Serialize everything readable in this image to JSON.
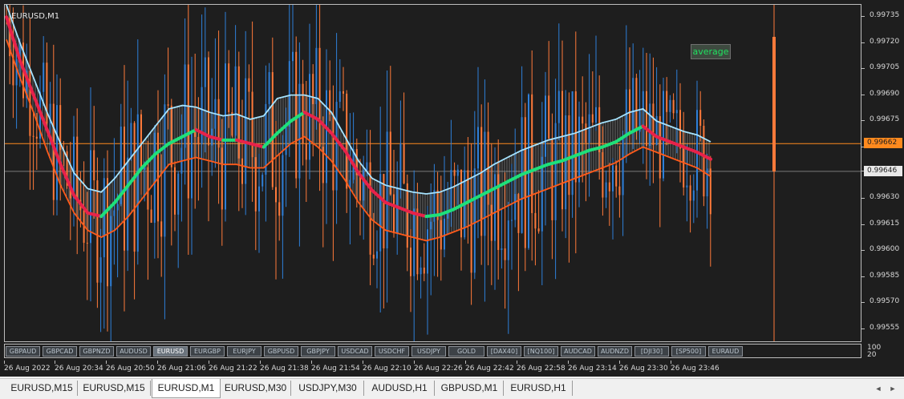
{
  "chart": {
    "title": "EURUSD,M1",
    "indicator_label": "average"
  },
  "chart_data": {
    "type": "candlestick",
    "symbol": "EURUSD",
    "timeframe": "M1",
    "y_range": [
      0.99548,
      0.99742
    ],
    "price_ticks": [
      "0.99735",
      "0.99720",
      "0.99705",
      "0.99690",
      "0.99675",
      "0.99660",
      "0.99646",
      "0.99630",
      "0.99615",
      "0.99600",
      "0.99585",
      "0.99570",
      "0.99555"
    ],
    "current_price": "0.99662",
    "bid_price": "0.99646",
    "time_ticks": [
      "26 Aug 2022",
      "26 Aug 20:34",
      "26 Aug 20:50",
      "26 Aug 21:06",
      "26 Aug 21:22",
      "26 Aug 21:38",
      "26 Aug 21:54",
      "26 Aug 22:10",
      "26 Aug 22:26",
      "26 Aug 22:42",
      "26 Aug 22:58",
      "26 Aug 23:14",
      "26 Aug 23:30",
      "26 Aug 23:46"
    ],
    "bullish_color": "#2e7fd8",
    "bearish_color": "#ff7a3a",
    "ma_up_color": "#1ee07a",
    "ma_down_color": "#e8224a",
    "upper_band_color": "#a6e4ff",
    "lower_band_color": "#ff5a1a",
    "ma": [
      0.99735,
      0.9971,
      0.9969,
      0.9967,
      0.9965,
      0.99632,
      0.99622,
      0.9962,
      0.99628,
      0.99638,
      0.99648,
      0.99656,
      0.99662,
      0.99666,
      0.9967,
      0.99666,
      0.99664,
      0.99664,
      0.99662,
      0.9966,
      0.99668,
      0.99675,
      0.9968,
      0.99676,
      0.99668,
      0.99658,
      0.99645,
      0.99635,
      0.99628,
      0.99625,
      0.99622,
      0.9962,
      0.99621,
      0.99624,
      0.99628,
      0.99632,
      0.99636,
      0.9964,
      0.99644,
      0.99647,
      0.9965,
      0.99652,
      0.99655,
      0.99658,
      0.9966,
      0.99663,
      0.99668,
      0.99672,
      0.99666,
      0.99663,
      0.9966,
      0.99657,
      0.99653
    ],
    "upper": [
      0.99742,
      0.9972,
      0.997,
      0.9968,
      0.99662,
      0.99645,
      0.99636,
      0.99634,
      0.99642,
      0.99652,
      0.99662,
      0.99672,
      0.99682,
      0.99684,
      0.99683,
      0.9968,
      0.99678,
      0.99679,
      0.99676,
      0.99678,
      0.99688,
      0.9969,
      0.9969,
      0.99688,
      0.9968,
      0.99666,
      0.99652,
      0.99642,
      0.99638,
      0.99636,
      0.99634,
      0.99633,
      0.99634,
      0.99637,
      0.99641,
      0.99645,
      0.9965,
      0.99654,
      0.99658,
      0.99661,
      0.99664,
      0.99666,
      0.99668,
      0.99671,
      0.99674,
      0.99676,
      0.9968,
      0.99682,
      0.99675,
      0.99672,
      0.99669,
      0.99667,
      0.99663
    ],
    "lower": [
      0.99722,
      0.997,
      0.9968,
      0.99658,
      0.99638,
      0.99622,
      0.99612,
      0.99608,
      0.99612,
      0.9962,
      0.9963,
      0.9964,
      0.9965,
      0.99652,
      0.99654,
      0.99652,
      0.9965,
      0.9965,
      0.99648,
      0.99648,
      0.99655,
      0.99662,
      0.99666,
      0.9966,
      0.99652,
      0.99641,
      0.99628,
      0.99618,
      0.99612,
      0.9961,
      0.99608,
      0.99606,
      0.99608,
      0.99611,
      0.99614,
      0.99618,
      0.99622,
      0.99626,
      0.9963,
      0.99633,
      0.99636,
      0.99639,
      0.99642,
      0.99645,
      0.99648,
      0.99651,
      0.99656,
      0.9966,
      0.99657,
      0.99654,
      0.99651,
      0.99648,
      0.99643
    ]
  },
  "symbols": [
    "GBPAUD",
    "GBPCAD",
    "GBPNZD",
    "AUDUSD",
    "EURUSD",
    "EURGBP",
    "EURJPY",
    "GBPUSD",
    "GBPJPY",
    "USDCAD",
    "USDCHF",
    "USDJPY",
    "GOLD",
    "[DAX40]",
    "[NQ100]",
    "AUDCAD",
    "AUDNZD",
    "[DJI30]",
    "[SP500]",
    "EURAUD"
  ],
  "active_symbol": "EURUSD",
  "subscale": {
    "top": "100",
    "bottom": "20"
  },
  "tabs": [
    "EURUSD,M15",
    "EURUSD,M15",
    "EURUSD,M1",
    "EURUSD,M30",
    "USDJPY,M30",
    "AUDUSD,H1",
    "GBPUSD,M1",
    "EURUSD,H1"
  ],
  "active_tab": 2,
  "scroll": {
    "left": "◄",
    "right": "►"
  }
}
